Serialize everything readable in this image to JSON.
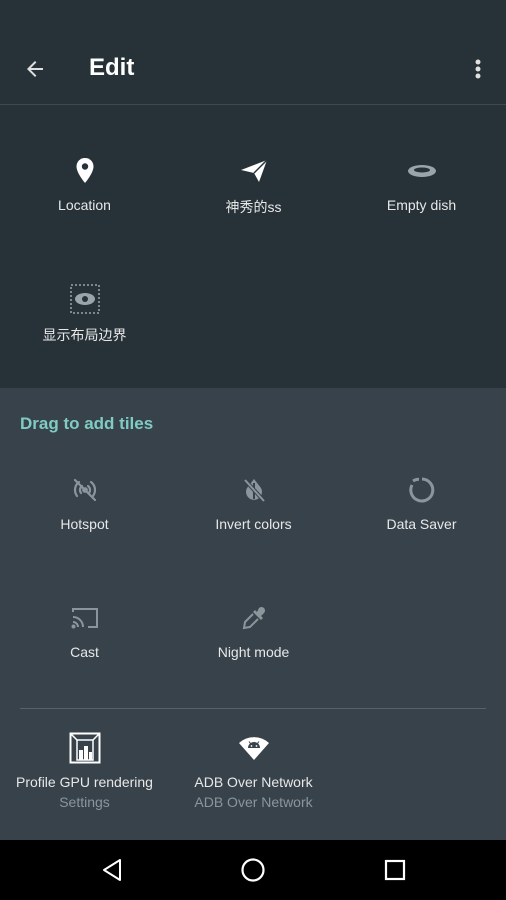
{
  "appbar": {
    "title": "Edit"
  },
  "current_tiles": [
    {
      "label": "Location",
      "icon": "location-pin-icon"
    },
    {
      "label": "神秀的ss",
      "icon": "paper-plane-icon"
    },
    {
      "label": "Empty dish",
      "icon": "dish-icon"
    },
    {
      "label": "显示布局边界",
      "icon": "layout-bounds-icon"
    }
  ],
  "drag_section": {
    "title": "Drag to add tiles",
    "tiles": [
      {
        "label": "Hotspot",
        "icon": "hotspot-off-icon"
      },
      {
        "label": "Invert colors",
        "icon": "invert-colors-icon"
      },
      {
        "label": "Data Saver",
        "icon": "data-saver-icon"
      },
      {
        "label": "Cast",
        "icon": "cast-icon"
      },
      {
        "label": "Night mode",
        "icon": "eyedropper-icon"
      }
    ],
    "third_party_tiles": [
      {
        "label": "Profile GPU rendering",
        "sublabel": "Settings",
        "icon": "gpu-profile-icon"
      },
      {
        "label": "ADB Over Network",
        "sublabel": "ADB Over Network",
        "icon": "adb-wifi-icon"
      }
    ]
  },
  "colors": {
    "background": "#263238",
    "add_area": "#37424a",
    "accent": "#80cbc4"
  }
}
